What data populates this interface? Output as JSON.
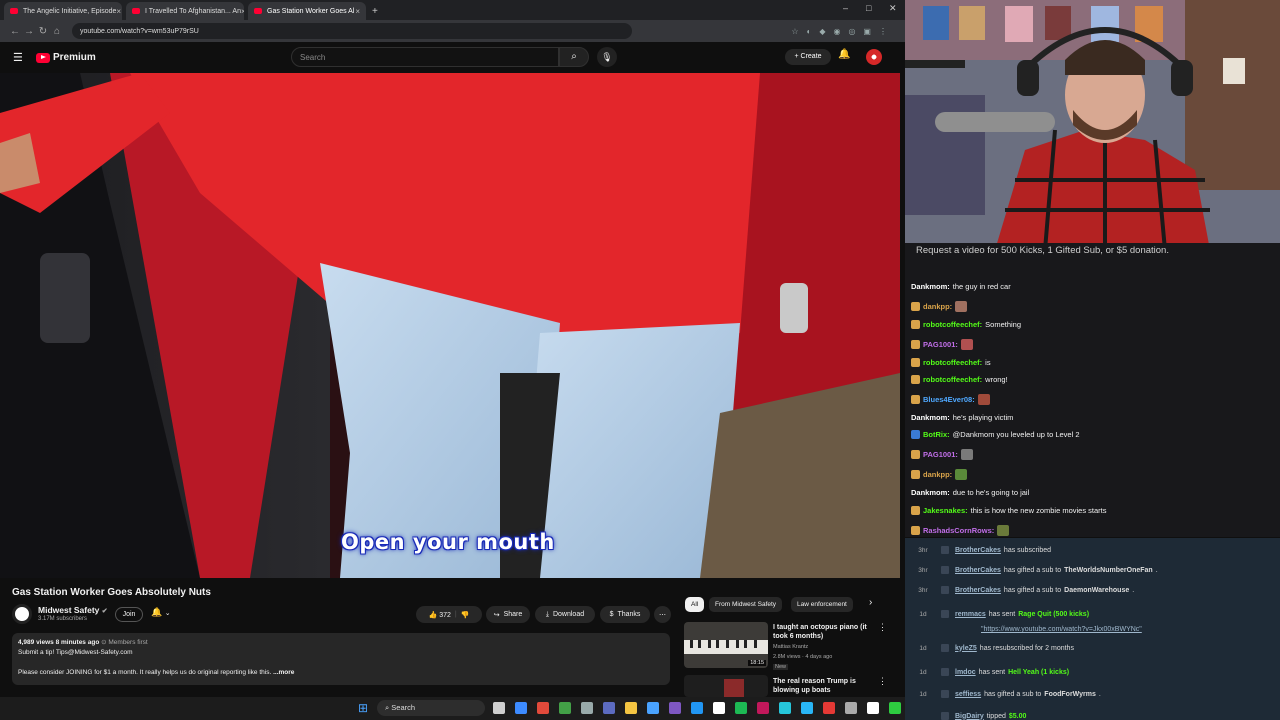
{
  "browser": {
    "tabs": [
      {
        "title": "The Angelic Initiative, Episode"
      },
      {
        "title": "I Travelled To Afghanistan... An"
      },
      {
        "title": "Gas Station Worker Goes Al"
      }
    ],
    "url": "youtube.com/watch?v=wm53uP79rSU"
  },
  "youtube": {
    "logo": "Premium",
    "search_placeholder": "Search",
    "create_label": "Create",
    "subtitle": "Open your mouth",
    "video_title": "Gas Station Worker Goes Absolutely Nuts",
    "channel": {
      "name": "Midwest Safety",
      "subscribers": "3.17M subscribers",
      "join": "Join"
    },
    "actions": {
      "likes": "372",
      "share": "Share",
      "download": "Download",
      "thanks": "Thanks"
    },
    "description": {
      "stats": "4,989 views  8 minutes ago",
      "members": "Members first",
      "line2": "Submit a tip! Tips@Midwest-Safety.com",
      "line3": "Please consider JOINING for $1 a month. It really helps us do original reporting like this.",
      "more": "...more"
    },
    "chips": [
      "All",
      "From Midwest Safety",
      "Law enforcement"
    ],
    "related": [
      {
        "title": "I taught an octopus piano (it took 6 months)",
        "channel": "Mattias Krantz",
        "meta": "2.8M views · 4 days ago",
        "badge": "New",
        "duration": "18:15"
      },
      {
        "title": "The real reason Trump is blowing up boats",
        "channel": "",
        "meta": "",
        "badge": "",
        "duration": ""
      }
    ]
  },
  "stream": {
    "request_banner": "Request a video for 500 Kicks, 1 Gifted Sub, or $5 donation.",
    "chat": [
      {
        "user": "Dankmom",
        "text": "the guy in red car",
        "color": "#ffffff"
      },
      {
        "user": "dankpp",
        "text": "",
        "color": "#d9a34a"
      },
      {
        "user": "robotcoffeechef",
        "text": "Something",
        "color": "#53fc18"
      },
      {
        "user": "PAG1001",
        "text": "",
        "color": "#c06ee8"
      },
      {
        "user": "robotcoffeechef",
        "text": "is",
        "color": "#53fc18"
      },
      {
        "user": "robotcoffeechef",
        "text": "wrong!",
        "color": "#53fc18"
      },
      {
        "user": "Blues4Ever08",
        "text": "",
        "color": "#4fa8ff"
      },
      {
        "user": "Dankmom",
        "text": "he's playing victim",
        "color": "#ffffff"
      },
      {
        "user": "BotRix",
        "text": "@Dankmom you leveled up to Level 2",
        "color": "#53fc18"
      },
      {
        "user": "PAG1001",
        "text": "",
        "color": "#c06ee8"
      },
      {
        "user": "dankpp",
        "text": "",
        "color": "#d9a34a"
      },
      {
        "user": "Dankmom",
        "text": "due to he's going to jail",
        "color": "#ffffff"
      },
      {
        "user": "Jakesnakes",
        "text": "this is how the new zombie movies starts",
        "color": "#53fc18"
      },
      {
        "user": "RashadsCornRows",
        "text": "",
        "color": "#c06ee8"
      }
    ],
    "alerts": [
      {
        "time": "3hr",
        "user": "BrotherCakes",
        "pre": "has subscribed",
        "bold": "",
        "post": ""
      },
      {
        "time": "3hr",
        "user": "BrotherCakes",
        "pre": "has gifted a sub to",
        "bold": "TheWorldsNumberOneFan",
        "post": "."
      },
      {
        "time": "3hr",
        "user": "BrotherCakes",
        "pre": "has gifted a sub to",
        "bold": "DaemonWarehouse",
        "post": "."
      },
      {
        "time": "1d",
        "user": "remmacs",
        "pre": "has sent",
        "green": "Rage Quit (500 kicks)",
        "post": ""
      },
      {
        "time": "",
        "user": "",
        "pre": "\"https://www.youtube.com/watch?v=Jkx00xBWYNc\"",
        "bold": "",
        "post": ""
      },
      {
        "time": "1d",
        "user": "kyleZ5",
        "pre": "has resubscribed for 2 months",
        "bold": "",
        "post": ""
      },
      {
        "time": "1d",
        "user": "lmdoc",
        "pre": "has sent",
        "green": "Hell Yeah (1 kicks)",
        "post": ""
      },
      {
        "time": "1d",
        "user": "seffiess",
        "pre": "has gifted a sub to",
        "bold": "FoodForWyrms",
        "post": "."
      },
      {
        "time": "",
        "user": "BigDairy",
        "pre": "tipped",
        "green": "$5.00",
        "post": ""
      }
    ]
  },
  "taskbar": {
    "search": "Search"
  }
}
